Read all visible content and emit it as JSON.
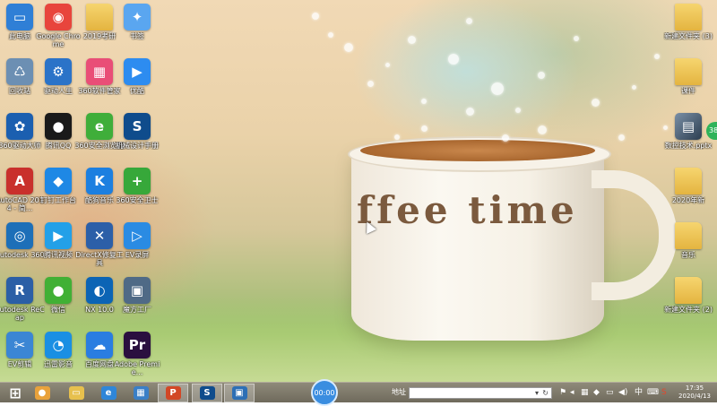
{
  "desktop": {
    "left_icons": [
      {
        "label": "此电脑",
        "icon": "computer-icon",
        "color": "#2f7fd6",
        "glyph": "▭"
      },
      {
        "label": "Google Chrome",
        "icon": "chrome-icon",
        "color": "#e8453c",
        "glyph": "◉"
      },
      {
        "label": "2019考研",
        "icon": "folder-icon",
        "color": "#f1c84a",
        "glyph": ""
      },
      {
        "label": "书签",
        "icon": "bookmark-icon",
        "color": "#5aa6f0",
        "glyph": "✦"
      },
      {
        "label": "回收站",
        "icon": "recycle-bin-icon",
        "color": "#6c8fb3",
        "glyph": "♺"
      },
      {
        "label": "驱动人生",
        "icon": "driver-icon",
        "color": "#2b73c8",
        "glyph": "⚙"
      },
      {
        "label": "360软件管家",
        "icon": "software-manager-icon",
        "color": "#e94e77",
        "glyph": "▦"
      },
      {
        "label": "优酷",
        "icon": "youku-icon",
        "color": "#2d8cf0",
        "glyph": "▶"
      },
      {
        "label": "360驱动大师",
        "icon": "driver-master-icon",
        "color": "#1b5fb0",
        "glyph": "✿"
      },
      {
        "label": "腾讯QQ",
        "icon": "qq-icon",
        "color": "#1a1a1a",
        "glyph": "●"
      },
      {
        "label": "360安全浏览器",
        "icon": "browser-icon",
        "color": "#3fae3a",
        "glyph": "e"
      },
      {
        "label": "机械设计手册",
        "icon": "solidworks-icon",
        "color": "#0f4c8c",
        "glyph": "S"
      },
      {
        "label": "AutoCAD 2014 - 简...",
        "icon": "autocad-icon",
        "color": "#c9302c",
        "glyph": "A"
      },
      {
        "label": "钉钉工作台",
        "icon": "dingtalk-icon",
        "color": "#1e88e5",
        "glyph": "◆"
      },
      {
        "label": "酷狗音乐",
        "icon": "kugou-icon",
        "color": "#1c7fe0",
        "glyph": "K"
      },
      {
        "label": "360安全卫士",
        "icon": "security-guard-icon",
        "color": "#37a83a",
        "glyph": "+"
      },
      {
        "label": "Autodesk 360",
        "icon": "autodesk-360-icon",
        "color": "#1d6fb8",
        "glyph": "◎"
      },
      {
        "label": "腾讯视频",
        "icon": "tencent-video-icon",
        "color": "#23a0e8",
        "glyph": "▶"
      },
      {
        "label": "DirectX修复工具",
        "icon": "directx-icon",
        "color": "#2c5fa8",
        "glyph": "✕"
      },
      {
        "label": "EV录屏",
        "icon": "ev-recorder-icon",
        "color": "#2a8be3",
        "glyph": "▷"
      },
      {
        "label": "Autodesk ReCap",
        "icon": "recap-icon",
        "color": "#2b5fa6",
        "glyph": "R"
      },
      {
        "label": "微信",
        "icon": "wechat-icon",
        "color": "#41b035",
        "glyph": "●"
      },
      {
        "label": "NX 10.0",
        "icon": "nx-icon",
        "color": "#0b64b5",
        "glyph": "◐"
      },
      {
        "label": "魔方工厂",
        "icon": "tool-icon",
        "color": "#4f6a86",
        "glyph": "▣"
      },
      {
        "label": "EV剪辑",
        "icon": "ev-editor-icon",
        "color": "#3b86d4",
        "glyph": "✂"
      },
      {
        "label": "迅雷影音",
        "icon": "player-icon",
        "color": "#1a8fe3",
        "glyph": "◔"
      },
      {
        "label": "百度网盘",
        "icon": "baidu-netdisk-icon",
        "color": "#2a7de1",
        "glyph": "☁"
      },
      {
        "label": "Adobe Premie...",
        "icon": "premiere-icon",
        "color": "#2a0f3f",
        "glyph": "Pr"
      }
    ],
    "right_icons": [
      {
        "label": "新建文件夹 (3)",
        "icon": "folder-icon",
        "type": "folder"
      },
      {
        "label": "课件",
        "icon": "folder-icon",
        "type": "folder"
      },
      {
        "label": "数控技术.pptx",
        "icon": "pptx-file-icon",
        "type": "file"
      },
      {
        "label": "2020年新",
        "icon": "folder-icon",
        "type": "folder"
      },
      {
        "label": "音乐",
        "icon": "folder-icon",
        "type": "folder"
      },
      {
        "label": "新建文件夹 (2)",
        "icon": "folder-icon",
        "type": "folder"
      }
    ],
    "side_badge": "38",
    "wallpaper_text": "ffee time"
  },
  "taskbar": {
    "pinned": [
      {
        "name": "start-button",
        "icon": "windows-icon",
        "glyph": "⊞",
        "color": ""
      },
      {
        "name": "taskbar-app-1",
        "icon": "app-store-icon",
        "glyph": "●",
        "color": "#e9a23b"
      },
      {
        "name": "taskbar-file-explorer",
        "icon": "file-explorer-icon",
        "glyph": "▭",
        "color": "#e7c04d"
      },
      {
        "name": "taskbar-ie",
        "icon": "internet-explorer-icon",
        "glyph": "e",
        "color": "#2f86d8"
      },
      {
        "name": "taskbar-control",
        "icon": "control-panel-icon",
        "glyph": "▦",
        "color": "#3a7fc6"
      },
      {
        "name": "taskbar-powerpoint",
        "icon": "powerpoint-icon",
        "glyph": "P",
        "color": "#d24726"
      },
      {
        "name": "taskbar-solidworks",
        "icon": "solidworks-icon",
        "glyph": "S",
        "color": "#0f4c8c"
      },
      {
        "name": "taskbar-window-app",
        "icon": "window-app-icon",
        "glyph": "▣",
        "color": "#2d6fb5"
      }
    ],
    "recorder_time": "00:00",
    "address_label": "地址",
    "address_value": "",
    "tray_icons": [
      "flag-icon",
      "network-icon",
      "speaker-icon",
      "input-method-icon",
      "security-tray-icon"
    ],
    "tray_ime_label": "中",
    "clock_time": "17:35",
    "clock_date": "2020/4/13"
  }
}
